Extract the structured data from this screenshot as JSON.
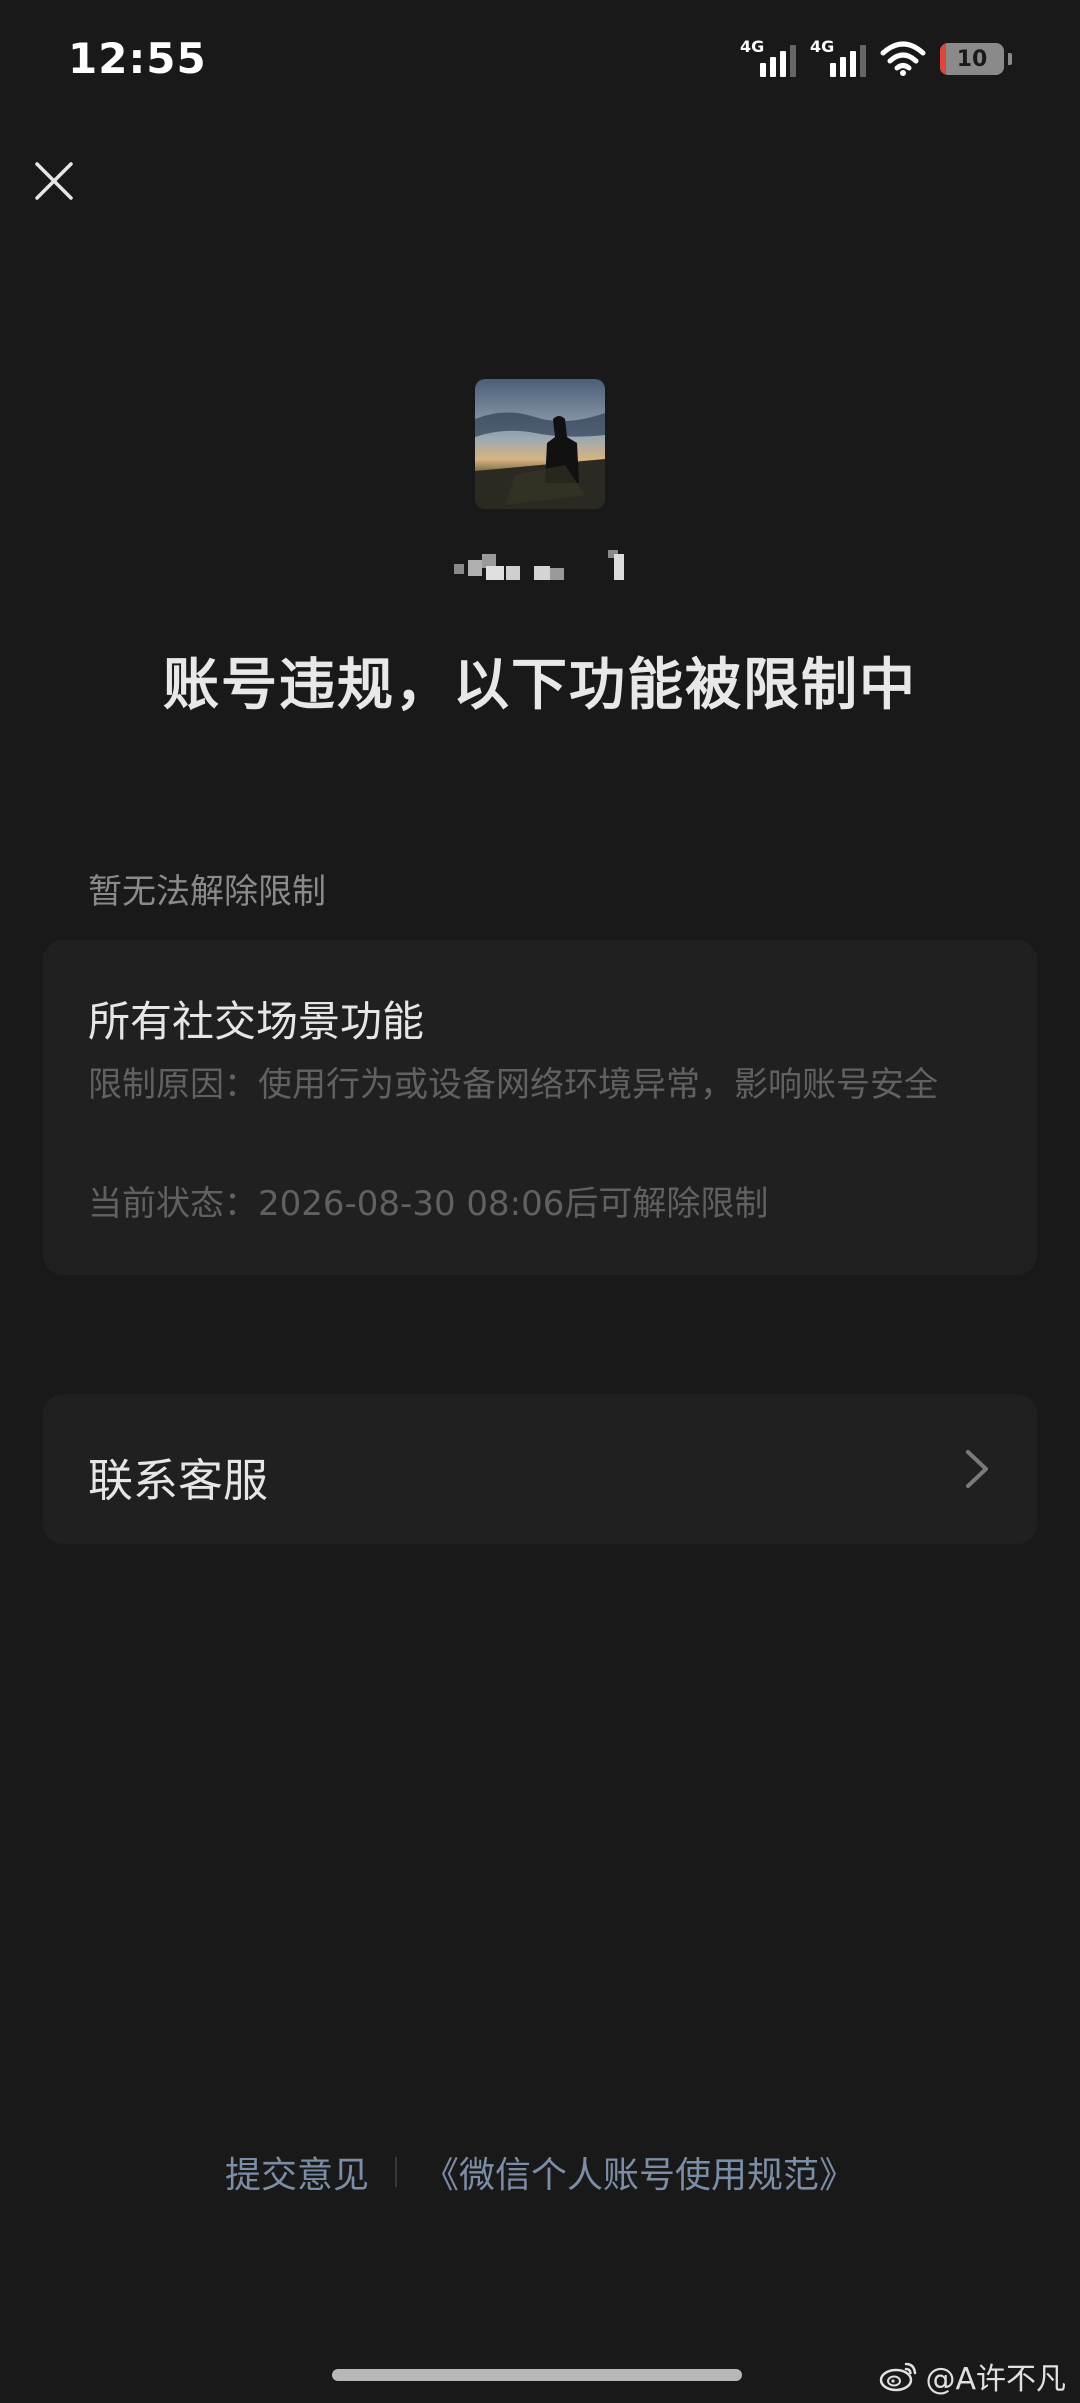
{
  "status_bar": {
    "time": "12:55",
    "network_1": "4G",
    "network_2": "4G",
    "battery": "10",
    "battery_level": 0.1,
    "battery_color": "#e0453b"
  },
  "header": {
    "close_icon": "close-icon"
  },
  "profile": {
    "nickname_masked": true
  },
  "headline": "账号违规，以下功能被限制中",
  "restriction_section": {
    "label": "暂无法解除限制",
    "card": {
      "title": "所有社交场景功能",
      "reason": "限制原因：使用行为或设备网络环境异常，影响账号安全",
      "status": "当前状态：2026-08-30 08:06后可解除限制"
    }
  },
  "support": {
    "label": "联系客服",
    "icon": "chevron-right-icon"
  },
  "footer": {
    "feedback": "提交意见",
    "policy": "《微信个人账号使用规范》",
    "link_color": "#7c8da6"
  },
  "watermark": {
    "text": "@A许不凡",
    "icon": "weibo-icon"
  }
}
